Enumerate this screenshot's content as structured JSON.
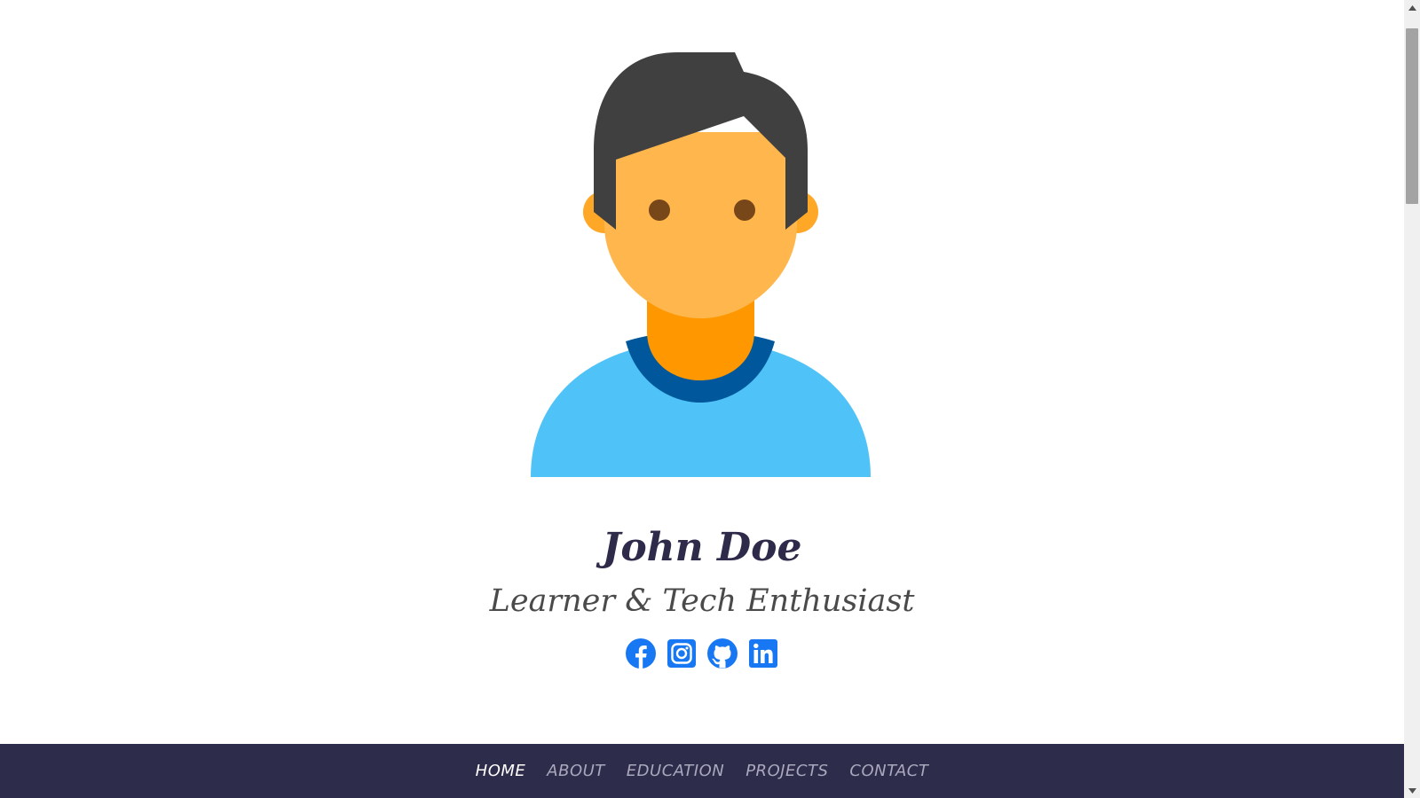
{
  "profile": {
    "name": "John Doe",
    "tagline": "Learner & Tech Enthusiast"
  },
  "socials": [
    {
      "icon": "facebook-icon"
    },
    {
      "icon": "instagram-icon"
    },
    {
      "icon": "github-icon"
    },
    {
      "icon": "linkedin-icon"
    }
  ],
  "nav": {
    "items": [
      {
        "label": "HOME",
        "active": true
      },
      {
        "label": "ABOUT",
        "active": false
      },
      {
        "label": "EDUCATION",
        "active": false
      },
      {
        "label": "PROJECTS",
        "active": false
      },
      {
        "label": "CONTACT",
        "active": false
      }
    ]
  },
  "colors": {
    "accent": "#1877f2",
    "nav_bg": "#2d2c4a",
    "name_text": "#2d2a4a",
    "hair": "#404040",
    "skin": "#ffb74d",
    "skin_dark": "#ffa726",
    "neck": "#ff9800",
    "shirt": "#4fc3f7",
    "collar": "#01579b",
    "eyes": "#784719"
  }
}
